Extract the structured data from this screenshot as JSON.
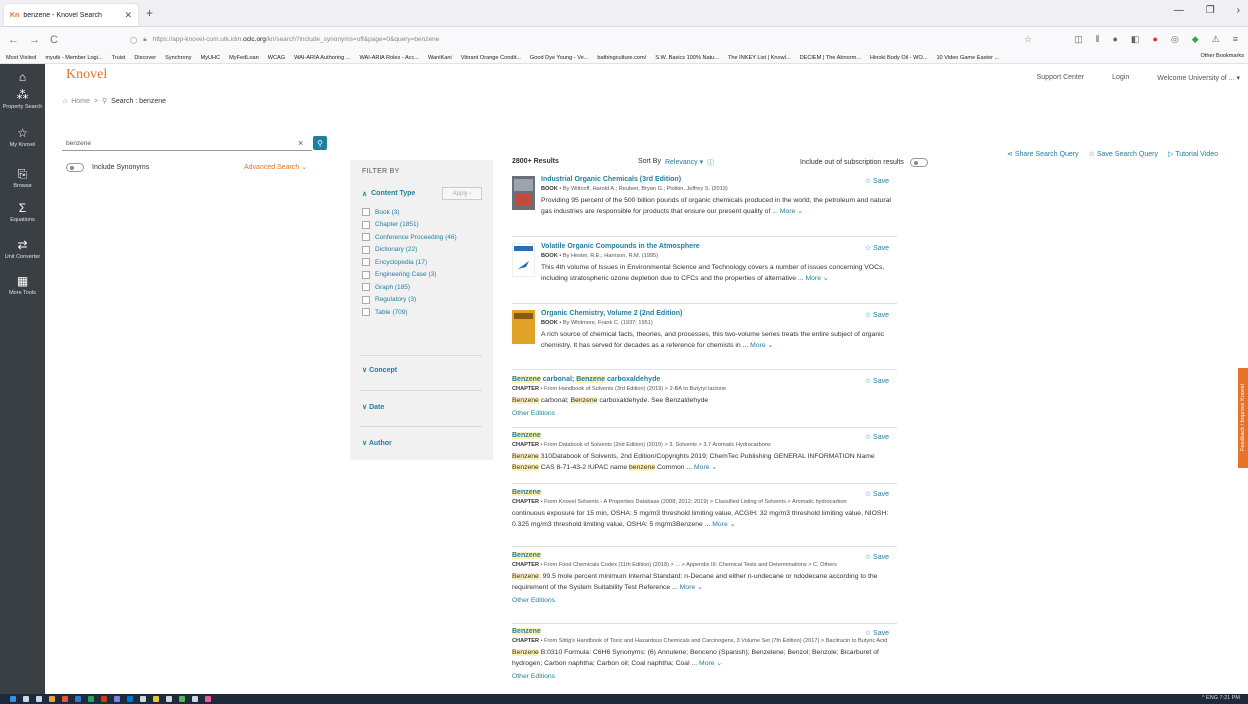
{
  "browser": {
    "tab_title": "benzene - Knovel Search",
    "tab_favicon": "Kn",
    "new_tab": "+",
    "url_prefix": "https://app-knovel-com.utk.idm.",
    "url_host": "oclc.org",
    "url_path": "/kn/search?include_synonyms=off&page=0&query=benzene",
    "bookmarks": [
      "Most Visited",
      "myutk - Member Logi...",
      "Truist",
      "Discover",
      "Synchrony",
      "MyUHC",
      "MyFedLoan",
      "WCAG",
      "WAI-ARIA Authoring ...",
      "WAI-ARIA Roles - Acc...",
      "WaniKani",
      "Vibrant Orange Condit...",
      "Good Dye Young - Ve...",
      "bathingculture.com/",
      "S.W. Basics 100% Natu...",
      "The INKEY List | Knowl...",
      "DECIEM | The Abnorm...",
      "Hinoki Body Oil - WO...",
      "10 Video Game Easter ..."
    ],
    "other_bookmarks": "Other Bookmarks"
  },
  "rail": {
    "items": [
      {
        "label": "Property Search",
        "icon": "property-search-icon"
      },
      {
        "label": "My Knovel",
        "icon": "star-icon"
      },
      {
        "label": "Browse",
        "icon": "browse-icon"
      },
      {
        "label": "Equations",
        "icon": "sigma-icon"
      },
      {
        "label": "Unit Converter",
        "icon": "converter-icon"
      },
      {
        "label": "More Tools",
        "icon": "grid-icon"
      }
    ]
  },
  "header": {
    "logo": "Knovel",
    "support": "Support Center",
    "login": "Login",
    "welcome": "Welcome University of ..."
  },
  "breadcrumb": {
    "home": "Home",
    "sep": ">",
    "current": "Search : benzene"
  },
  "search": {
    "query": "benzene",
    "clear": "×",
    "include_synonyms": "Include Synonyms",
    "advanced": "Advanced Search"
  },
  "actions": {
    "share": "Share Search Query",
    "save": "Save Search Query",
    "tutorial": "Tutorial Video"
  },
  "filter": {
    "title": "FILTER BY",
    "content_type": "Content Type",
    "apply": "Apply",
    "options": [
      "Book (3)",
      "Chapter (1851)",
      "Conference Proceeding (46)",
      "Dictionary (22)",
      "Encyclopedia (17)",
      "Engineering Case (3)",
      "Graph (185)",
      "Regulatory (3)",
      "Table (709)"
    ],
    "sections": [
      "Concept",
      "Date",
      "Author"
    ]
  },
  "results_header": {
    "count": "2800+ Results",
    "sort_label": "Sort By",
    "sort_value": "Relevancy",
    "include_out": "Include out of subscription results"
  },
  "results": [
    {
      "title": "Industrial Organic Chemicals (3rd Edition)",
      "type": "BOOK",
      "meta": "By Wittcoff, Harold A.; Reuben, Bryan G.; Plotkin, Jeffrey S. (2013)",
      "desc": "Providing 95 percent of the 500 billion pounds of organic chemicals produced in the world, the petroleum and natural gas industries are responsible for products that ensure our present quality of ...",
      "more": "More"
    },
    {
      "title": "Volatile Organic Compounds in the Atmosphere",
      "type": "BOOK",
      "meta": "By Hester, R.E.; Harrison, R.M. (1995)",
      "desc": "This 4th volume of Issues in Environmental Science and Technology covers a number of issues concerning VOCs, including stratospheric ozone depletion due to CFCs and the properties of alternative ...",
      "more": "More"
    },
    {
      "title": "Organic Chemistry, Volume 2 (2nd Edition)",
      "type": "BOOK",
      "meta": "By Whitmore, Frank C. (1937; 1951)",
      "desc": "A rich source of chemical facts, theories, and processes, this two-volume series treats the entire subject of organic chemistry. It has served for decades as a reference for chemists in ...",
      "more": "More"
    },
    {
      "title_a": "Benzene",
      "title_b": " carbonal; ",
      "title_c": "Benzene",
      "title_d": " carboxaldehyde",
      "type": "CHAPTER",
      "meta": "From Handbook of Solvents (3rd Edition) (2019) > 2-BA to Butyryl lactone",
      "desc_hl": "Benzene",
      "desc_mid": " carbonal; ",
      "desc_hl2": "Benzene",
      "desc_rest": " carboxaldehyde. See Benzaldehyde",
      "other": "Other Editions"
    },
    {
      "title": "Benzene",
      "type": "CHAPTER",
      "meta": "From Databook of Solvents (2nd Edition) (2019) > 3. Solvents > 3.7 Aromatic Hydrocarbons",
      "desc_hl": "Benzene",
      "desc_a": " 310Databook of Solvents, 2nd Edition/Copyrights 2019; ChemTec Publishing GENERAL INFORMATION Name ",
      "desc_hl2": "Benzene",
      "desc_b": " CAS 8-71-43-2 IUPAC name ",
      "desc_hl3": "benzene",
      "desc_c": " Common ...",
      "more": "More"
    },
    {
      "title": "Benzene",
      "type": "CHAPTER",
      "meta": "From Knovel Solvents - A Properties Database (2008; 2012; 2019) > Classified Listing of Solvents > Aromatic hydrocarbon",
      "desc": "continuous exposure for 15 min, OSHA: 5 mg/m3 threshold limiting value, ACGIH: 32 mg/m3 threshold limiting value, NIOSH: 0.325 mg/m3 threshold limiting value, OSHA: 5 mg/m3Benzene ...",
      "more": "More"
    },
    {
      "title": "Benzene",
      "type": "CHAPTER",
      "meta": "From Food Chemicals Codex (11th Edition) (2018) > ... > Appendix III: Chemical Tests and Determinations > C. Others",
      "desc_hl": "Benzene",
      "desc_rest": ": 99.5 mole percent minimum Internal Standard: n-Decane and either n-undecane or ndodecane according to the requirement of the System Suitability Test Reference ...",
      "more": "More",
      "other": "Other Editions"
    },
    {
      "title": "Benzene",
      "type": "CHAPTER",
      "meta": "From Sittig's Handbook of Toxic and Hazardous Chemicals and Carcinogens, 3 Volume Set (7th Edition) (2017) > Bacitracin to Butyric Acid",
      "desc_hl": "Benzene",
      "desc_rest": " B:0310 Formula: C6H6 Synonyms: (6) Annulene; Benceno (Spanish); Benzelene; Benzol; Benzole; Bicarburet of hydrogen; Carbon naphtha; Carbon oil; Coal naphtha; Coal ...",
      "more": "More",
      "other": "Other Editions"
    }
  ],
  "save_label": "Save",
  "feedback": "Feedback / Improve Knovel",
  "taskbar_right": "^ ENG 7:21 PM"
}
